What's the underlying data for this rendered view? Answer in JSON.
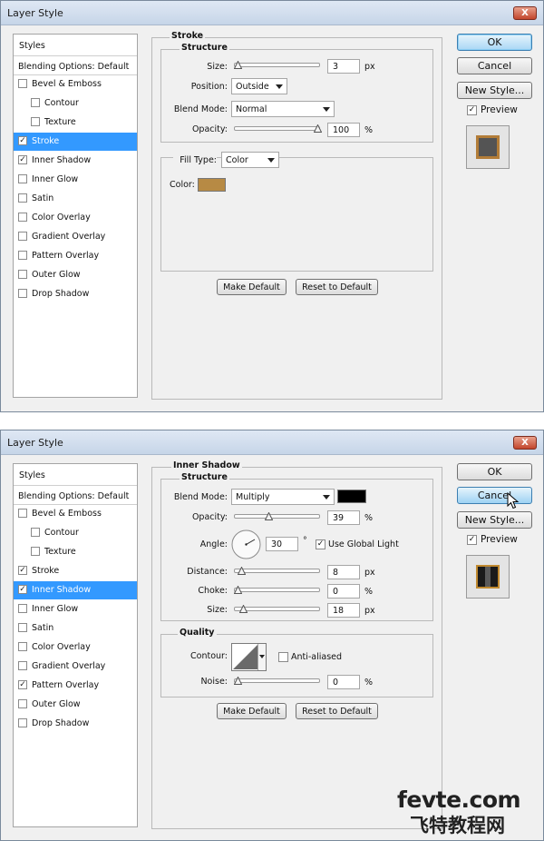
{
  "dialog1": {
    "title": "Layer Style",
    "close": "X",
    "sidebar": {
      "header": "Styles",
      "blending": "Blending Options: Default",
      "items": [
        {
          "label": "Bevel & Emboss",
          "checked": false
        },
        {
          "label": "Contour",
          "checked": false
        },
        {
          "label": "Texture",
          "checked": false
        },
        {
          "label": "Stroke",
          "checked": true
        },
        {
          "label": "Inner Shadow",
          "checked": true
        },
        {
          "label": "Inner Glow",
          "checked": false
        },
        {
          "label": "Satin",
          "checked": false
        },
        {
          "label": "Color Overlay",
          "checked": false
        },
        {
          "label": "Gradient Overlay",
          "checked": false
        },
        {
          "label": "Pattern Overlay",
          "checked": false
        },
        {
          "label": "Outer Glow",
          "checked": false
        },
        {
          "label": "Drop Shadow",
          "checked": false
        }
      ],
      "selected": "Stroke"
    },
    "panel": {
      "title": "Stroke",
      "structure": "Structure",
      "size_label": "Size:",
      "size_value": "3",
      "size_unit": "px",
      "position_label": "Position:",
      "position_value": "Outside",
      "blend_label": "Blend Mode:",
      "blend_value": "Normal",
      "opacity_label": "Opacity:",
      "opacity_value": "100",
      "opacity_unit": "%",
      "fill_type_label": "Fill Type:",
      "fill_type_value": "Color",
      "color_label": "Color:",
      "color_swatch": "#b78a44",
      "make_default": "Make Default",
      "reset_default": "Reset to Default"
    },
    "buttons": {
      "ok": "OK",
      "cancel": "Cancel",
      "new_style": "New Style..."
    },
    "preview_label": "Preview",
    "preview_checked": true
  },
  "dialog2": {
    "title": "Layer Style",
    "close": "X",
    "sidebar": {
      "header": "Styles",
      "blending": "Blending Options: Default",
      "items": [
        {
          "label": "Bevel & Emboss",
          "checked": false
        },
        {
          "label": "Contour",
          "checked": false
        },
        {
          "label": "Texture",
          "checked": false
        },
        {
          "label": "Stroke",
          "checked": true
        },
        {
          "label": "Inner Shadow",
          "checked": true
        },
        {
          "label": "Inner Glow",
          "checked": false
        },
        {
          "label": "Satin",
          "checked": false
        },
        {
          "label": "Color Overlay",
          "checked": false
        },
        {
          "label": "Gradient Overlay",
          "checked": false
        },
        {
          "label": "Pattern Overlay",
          "checked": true
        },
        {
          "label": "Outer Glow",
          "checked": false
        },
        {
          "label": "Drop Shadow",
          "checked": false
        }
      ],
      "selected": "Inner Shadow"
    },
    "panel": {
      "title": "Inner Shadow",
      "structure": "Structure",
      "blend_label": "Blend Mode:",
      "blend_value": "Multiply",
      "blend_color": "#000000",
      "opacity_label": "Opacity:",
      "opacity_value": "39",
      "opacity_unit": "%",
      "angle_label": "Angle:",
      "angle_value": "30",
      "angle_unit": "°",
      "global_light_label": "Use Global Light",
      "global_light_checked": true,
      "distance_label": "Distance:",
      "distance_value": "8",
      "distance_unit": "px",
      "choke_label": "Choke:",
      "choke_value": "0",
      "choke_unit": "%",
      "size_label": "Size:",
      "size_value": "18",
      "size_unit": "px",
      "quality": "Quality",
      "contour_label": "Contour:",
      "anti_aliased_label": "Anti-aliased",
      "anti_aliased_checked": false,
      "noise_label": "Noise:",
      "noise_value": "0",
      "noise_unit": "%",
      "make_default": "Make Default",
      "reset_default": "Reset to Default"
    },
    "buttons": {
      "ok": "OK",
      "cancel": "Cancel",
      "new_style": "New Style..."
    },
    "preview_label": "Preview",
    "preview_checked": true
  },
  "watermark": {
    "line1": "fevte.com",
    "line2": "飞特教程网"
  },
  "check_glyph": "✓"
}
